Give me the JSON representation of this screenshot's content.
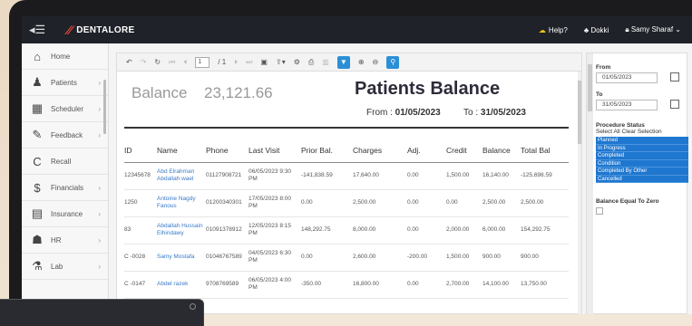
{
  "app": {
    "brand": "DENTALORE"
  },
  "topbar": {
    "help": "Help?",
    "clinic": "Dokki",
    "user": "Samy Sharaf"
  },
  "sidebar": {
    "items": [
      {
        "label": "Home",
        "icon": "home-icon",
        "glyph": "⌂"
      },
      {
        "label": "Patients",
        "icon": "person-icon",
        "glyph": "♟"
      },
      {
        "label": "Scheduler",
        "icon": "calendar-icon",
        "glyph": "▦"
      },
      {
        "label": "Feedback",
        "icon": "chat-icon",
        "glyph": "✎"
      },
      {
        "label": "Recall",
        "icon": "recall-icon",
        "glyph": "C"
      },
      {
        "label": "Financials",
        "icon": "dollar-icon",
        "glyph": "$"
      },
      {
        "label": "Insurance",
        "icon": "document-icon",
        "glyph": "▤"
      },
      {
        "label": "HR",
        "icon": "group-icon",
        "glyph": "☗"
      },
      {
        "label": "Lab",
        "icon": "flask-icon",
        "glyph": "⚗"
      }
    ]
  },
  "toolbar": {
    "page_input": "1",
    "page_total": "/ 1"
  },
  "report": {
    "balance_label": "Balance",
    "balance_value": "23,121.66",
    "title": "Patients Balance",
    "from_label": "From :",
    "from_value": "01/05/2023",
    "to_label": "To :",
    "to_value": "31/05/2023",
    "columns": [
      "ID",
      "Name",
      "Phone",
      "Last Visit",
      "Prior Bal.",
      "Charges",
      "Adj.",
      "Credit",
      "Balance",
      "Total Bal"
    ],
    "rows": [
      [
        "12345678",
        "Abd Elrahman Abdallah wael",
        "01127908721",
        "06/05/2023 9:30 PM",
        "-141,838.59",
        "17,640.00",
        "0.00",
        "1,500.00",
        "16,140.00",
        "-125,698.59"
      ],
      [
        "1250",
        "Antoine Nagdy Fanous",
        "01200340301",
        "17/05/2023 8:00 PM",
        "0.00",
        "2,500.00",
        "0.00",
        "0.00",
        "2,500.00",
        "2,500.00"
      ],
      [
        "83",
        "Abdallah Hussain Elhindawy",
        "01091378912",
        "12/05/2023 8:15 PM",
        "148,292.75",
        "8,000.00",
        "0.00",
        "2,000.00",
        "6,000.00",
        "154,292.75"
      ],
      [
        "C -0028",
        "Samy Mostafa",
        "01046767589",
        "04/05/2023 6:30 PM",
        "0.00",
        "2,600.00",
        "-200.00",
        "1,500.00",
        "900.00",
        "900.00"
      ],
      [
        "C -0147",
        "Abdel razek",
        "9708769589",
        "06/05/2023 4:00 PM",
        "-350.00",
        "16,800.00",
        "0.00",
        "2,700.00",
        "14,100.00",
        "13,750.00"
      ]
    ]
  },
  "filters": {
    "from_label": "From",
    "from_value": "01/05/2023",
    "to_label": "To",
    "to_value": "31/05/2023",
    "status_label": "Procedure Status",
    "status_hint": "Select All  Clear Selection",
    "statuses": [
      "Planned",
      "In Progress",
      "Completed",
      "Condition",
      "Completed By Other",
      "Cancelled"
    ],
    "zero_label": "Balance Equal To Zero"
  }
}
